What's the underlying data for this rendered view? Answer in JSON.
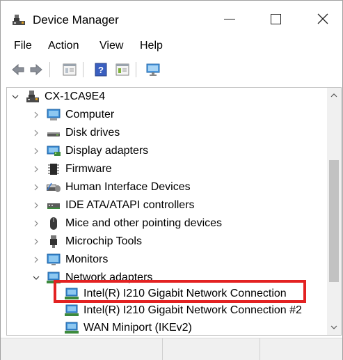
{
  "window": {
    "title": "Device Manager",
    "icon": "device-manager-icon"
  },
  "menu": {
    "file": "File",
    "action": "Action",
    "view": "View",
    "help": "Help"
  },
  "toolbar": {
    "buttons": [
      "back-arrow-icon",
      "forward-arrow-icon",
      "properties-icon",
      "help-icon",
      "update-driver-icon",
      "monitor-scan-icon"
    ]
  },
  "tree": {
    "root": "CX-1CA9E4",
    "categories": [
      {
        "label": "Computer",
        "icon": "computer-icon"
      },
      {
        "label": "Disk drives",
        "icon": "disk-drive-icon"
      },
      {
        "label": "Display adapters",
        "icon": "display-adapter-icon"
      },
      {
        "label": "Firmware",
        "icon": "firmware-icon"
      },
      {
        "label": "Human Interface Devices",
        "icon": "hid-icon"
      },
      {
        "label": "IDE ATA/ATAPI controllers",
        "icon": "ide-controller-icon"
      },
      {
        "label": "Mice and other pointing devices",
        "icon": "mouse-icon"
      },
      {
        "label": "Microchip Tools",
        "icon": "microchip-tools-icon"
      },
      {
        "label": "Monitors",
        "icon": "monitor-icon"
      },
      {
        "label": "Network adapters",
        "icon": "network-adapter-icon"
      }
    ],
    "network_children": [
      {
        "label": "Intel(R) I210 Gigabit Network Connection"
      },
      {
        "label": "Intel(R) I210 Gigabit Network Connection #2"
      },
      {
        "label": "WAN Miniport (IKEv2)"
      }
    ]
  },
  "colors": {
    "highlight": "#e32222",
    "scroll_thumb": "#c2c2c2"
  }
}
